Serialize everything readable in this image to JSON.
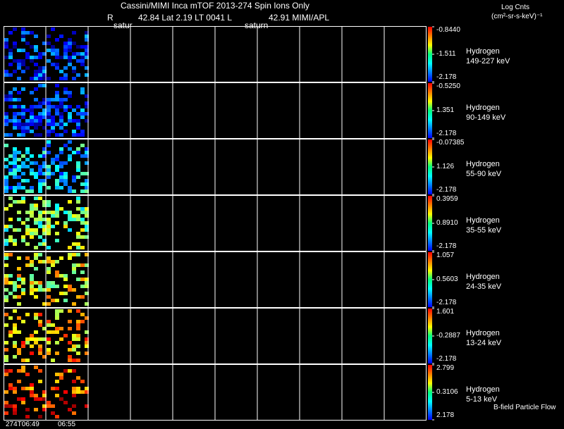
{
  "header": {
    "title": "Cassini/MIMI Inca mTOF  2013-274   Spin   Ions Only",
    "r_label": "R",
    "position_text": "42.84 Lat 2.19 LT 0041 L",
    "l_value_text": "42.91  MIMI/APL",
    "saturn_label_1": "satur",
    "saturn_label_2": "saturn",
    "units_line1": "Log Cnts",
    "units_line2": "(cm²-sr-s-keV)⁻¹"
  },
  "footer": {
    "time_start": "274T06:49",
    "time_next": "06:55",
    "bfield_note": "B-field Particle Flow"
  },
  "colors": {
    "background": "#000000",
    "grid": "#ffffff",
    "colorbar": [
      "#ff0000",
      "#ff7f00",
      "#ffff00",
      "#00ff80",
      "#00ffff",
      "#0080ff",
      "#0000ff"
    ]
  },
  "chart_data": {
    "type": "heatmap",
    "columns_total": 10,
    "columns_with_data": 2,
    "time_labels": [
      "274T06:49",
      "06:55"
    ],
    "panels": [
      {
        "species": "Hydrogen",
        "energy": "149-227 keV",
        "cbar_max": "-0.8440",
        "cbar_mid": "-1.511",
        "cbar_min": "-2.178",
        "level": 0.15,
        "density": 0.55,
        "seed": 11
      },
      {
        "species": "Hydrogen",
        "energy": "90-149 keV",
        "cbar_max": "-0.5250",
        "cbar_mid": "1.351",
        "cbar_min": "-2.178",
        "level": 0.18,
        "density": 0.6,
        "seed": 23
      },
      {
        "species": "Hydrogen",
        "energy": "55-90 keV",
        "cbar_max": "-0.07385",
        "cbar_mid": "1.126",
        "cbar_min": "-2.178",
        "level": 0.32,
        "density": 0.55,
        "seed": 37
      },
      {
        "species": "Hydrogen",
        "energy": "35-55 keV",
        "cbar_max": "0.3959",
        "cbar_mid": "0.8910",
        "cbar_min": "-2.178",
        "level": 0.5,
        "density": 0.55,
        "seed": 41
      },
      {
        "species": "Hydrogen",
        "energy": "24-35 keV",
        "cbar_max": "1.057",
        "cbar_mid": "0.5603",
        "cbar_min": "-2.178",
        "level": 0.6,
        "density": 0.45,
        "seed": 53
      },
      {
        "species": "Hydrogen",
        "energy": "13-24 keV",
        "cbar_max": "1.601",
        "cbar_mid": "-0.2887",
        "cbar_min": "-2.178",
        "level": 0.7,
        "density": 0.4,
        "seed": 67
      },
      {
        "species": "Hydrogen",
        "energy": "5-13 keV",
        "cbar_max": "2.799",
        "cbar_mid": "0.3106",
        "cbar_min": "2.178",
        "level": 0.82,
        "density": 0.32,
        "seed": 79
      }
    ]
  }
}
